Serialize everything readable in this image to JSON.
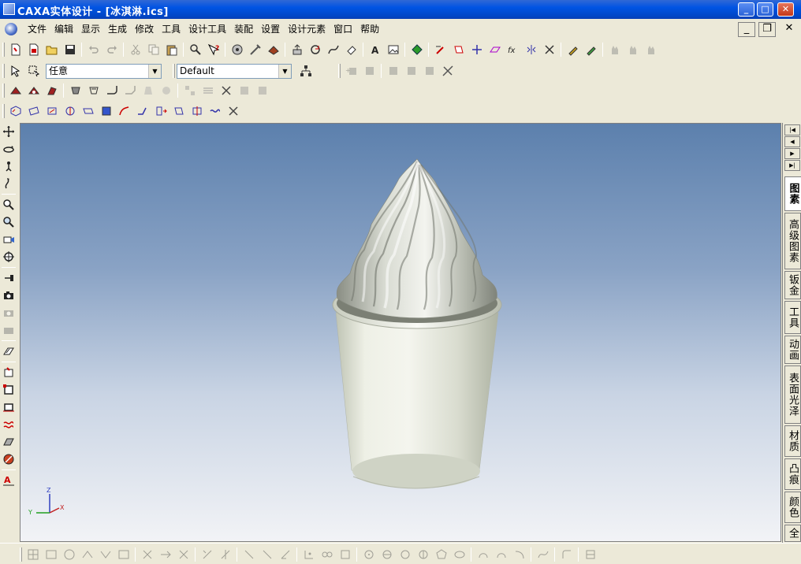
{
  "window": {
    "title": "CAXA实体设计 - [冰淇淋.ics]",
    "controls": {
      "minimize": "_",
      "maximize": "□",
      "close": "✕"
    }
  },
  "menu": {
    "items": [
      "文件",
      "编辑",
      "显示",
      "生成",
      "修改",
      "工具",
      "设计工具",
      "装配",
      "设置",
      "设计元素",
      "窗口",
      "帮助"
    ],
    "mdi_controls": {
      "minimize": "_",
      "restore": "❐",
      "close": "✕"
    }
  },
  "toolbar": {
    "selection_filter": {
      "value": "任意"
    },
    "style_combo": {
      "value": "Default"
    }
  },
  "viewport": {
    "axis_labels": {
      "x": "X",
      "y": "Y",
      "z": "Z"
    },
    "colors": {
      "background_top": "#5c80ad",
      "background_bottom": "#f2f3f6",
      "model": "#dfe1d6"
    }
  },
  "right_panel": {
    "nav_buttons": [
      "|◀",
      "◀",
      "▶",
      "▶|"
    ],
    "tabs": [
      {
        "label": "图素",
        "active": true
      },
      {
        "label": "高级图素",
        "active": false
      },
      {
        "label": "钣金",
        "active": false
      },
      {
        "label": "工具",
        "active": false
      },
      {
        "label": "动画",
        "active": false
      },
      {
        "label": "表面光泽",
        "active": false
      },
      {
        "label": "材质",
        "active": false
      },
      {
        "label": "凸痕",
        "active": false
      },
      {
        "label": "颜色",
        "active": false
      },
      {
        "label": "全",
        "active": false
      }
    ]
  }
}
